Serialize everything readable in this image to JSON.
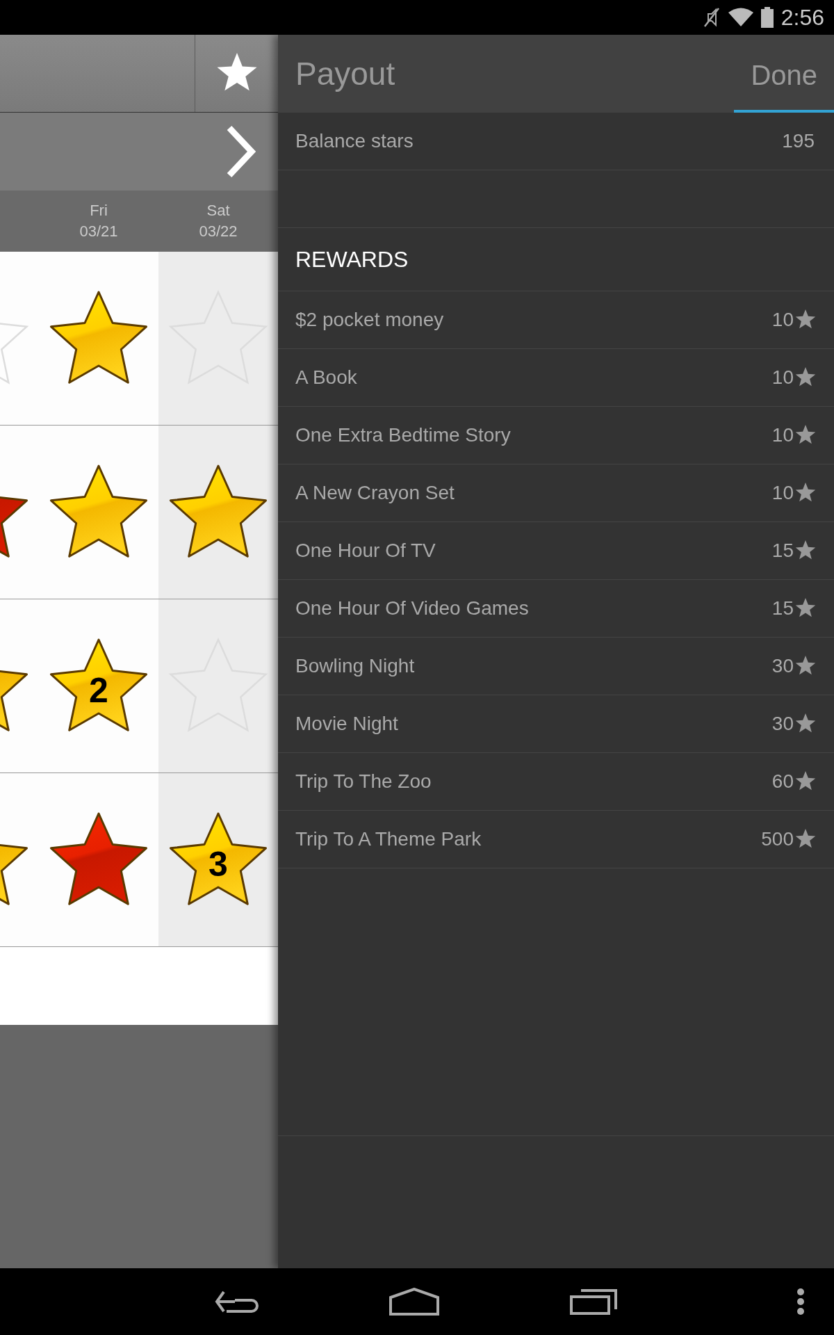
{
  "status_bar": {
    "time": "2:56"
  },
  "days": [
    {
      "selected": false
    },
    {
      "day": "Fri",
      "date": "03/21",
      "selected": false
    },
    {
      "day": "Sat",
      "date": "03/22",
      "selected": true
    }
  ],
  "grid_rows": [
    {
      "cells": [
        {
          "kind": "empty"
        },
        {
          "kind": "gold"
        },
        {
          "kind": "empty"
        }
      ]
    },
    {
      "cells": [
        {
          "kind": "red"
        },
        {
          "kind": "gold"
        },
        {
          "kind": "gold"
        }
      ]
    },
    {
      "cells": [
        {
          "kind": "gold"
        },
        {
          "kind": "gold",
          "number": "2"
        },
        {
          "kind": "empty"
        }
      ]
    },
    {
      "cells": [
        {
          "kind": "gold"
        },
        {
          "kind": "red"
        },
        {
          "kind": "gold",
          "number": "3"
        }
      ]
    }
  ],
  "payout": {
    "title": "Payout",
    "done": "Done",
    "balance_label": "Balance stars",
    "balance": "195",
    "section": "REWARDS",
    "rewards": [
      {
        "name": "$2 pocket money",
        "cost": "10"
      },
      {
        "name": "A Book",
        "cost": "10"
      },
      {
        "name": "One Extra Bedtime Story",
        "cost": "10"
      },
      {
        "name": "A New Crayon Set",
        "cost": "10"
      },
      {
        "name": "One Hour Of TV",
        "cost": "15"
      },
      {
        "name": "One Hour Of Video Games",
        "cost": "15"
      },
      {
        "name": "Bowling Night",
        "cost": "30"
      },
      {
        "name": "Movie Night",
        "cost": "30"
      },
      {
        "name": "Trip To The Zoo",
        "cost": "60"
      },
      {
        "name": "Trip To A Theme Park",
        "cost": "500"
      }
    ]
  }
}
